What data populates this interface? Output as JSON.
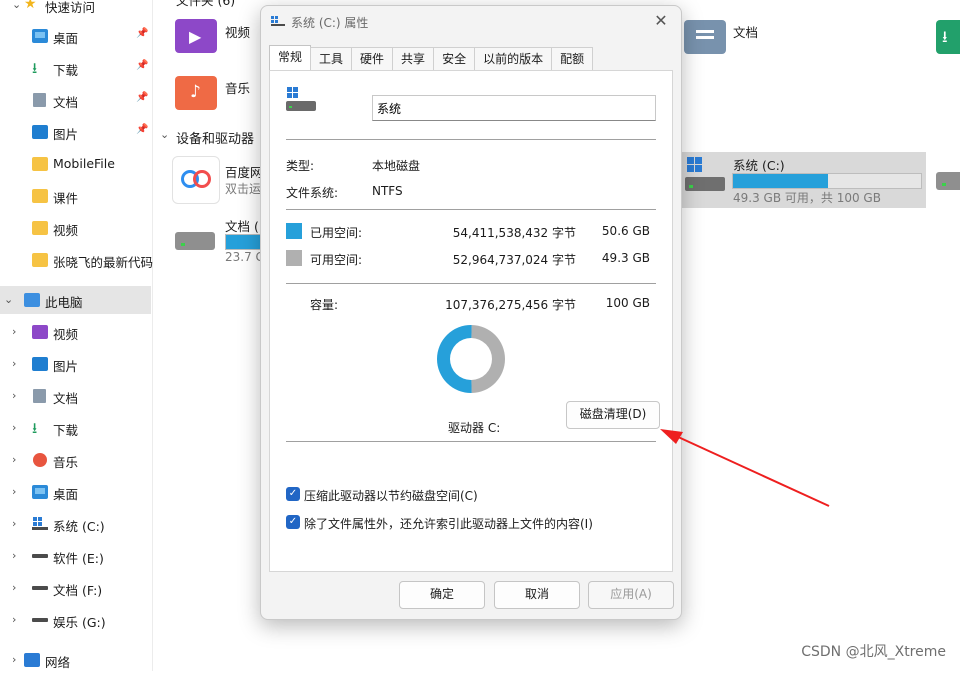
{
  "sidebar": {
    "quick_access_label": "快速访问",
    "quick_items": [
      {
        "label": "桌面",
        "icon": "desktop-icon"
      },
      {
        "label": "下载",
        "icon": "download-icon"
      },
      {
        "label": "文档",
        "icon": "document-icon"
      },
      {
        "label": "图片",
        "icon": "pictures-icon"
      },
      {
        "label": "MobileFile",
        "icon": "folder-icon"
      },
      {
        "label": "课件",
        "icon": "folder-icon"
      },
      {
        "label": "视频",
        "icon": "folder-icon"
      },
      {
        "label": "张晓飞的最新代码",
        "icon": "folder-icon"
      }
    ],
    "this_pc_label": "此电脑",
    "pc_items": [
      {
        "label": "视频",
        "icon": "videos-icon"
      },
      {
        "label": "图片",
        "icon": "pictures-icon"
      },
      {
        "label": "文档",
        "icon": "document-icon"
      },
      {
        "label": "下载",
        "icon": "download-icon"
      },
      {
        "label": "音乐",
        "icon": "music-icon"
      },
      {
        "label": "桌面",
        "icon": "desktop-icon"
      },
      {
        "label": "系统 (C:)",
        "icon": "windows-drive-icon"
      },
      {
        "label": "软件 (E:)",
        "icon": "drive-icon"
      },
      {
        "label": "文档 (F:)",
        "icon": "drive-icon"
      },
      {
        "label": "娱乐 (G:)",
        "icon": "drive-icon"
      }
    ],
    "network_label": "网络"
  },
  "content": {
    "folders_header": "文件夹 (6)",
    "folders": [
      "视频",
      "音乐",
      "文档"
    ],
    "devices_header": "设备和驱动器",
    "baidu_name": "百度网",
    "baidu_sub": "双击运",
    "doc_drive_name": "文档 (F",
    "doc_drive_free": "23.7 G",
    "c_drive_name": "系统 (C:)",
    "c_drive_free": "49.3 GB 可用，共 100 GB",
    "c_drive_used_fraction": 0.506
  },
  "dialog": {
    "title": "系统 (C:) 属性",
    "tabs": [
      "常规",
      "工具",
      "硬件",
      "共享",
      "安全",
      "以前的版本",
      "配额"
    ],
    "active_tab": "常规",
    "name_value": "系统",
    "type_label": "类型:",
    "type_value": "本地磁盘",
    "fs_label": "文件系统:",
    "fs_value": "NTFS",
    "used_label": "已用空间:",
    "used_bytes": "54,411,538,432 字节",
    "used_gb": "50.6 GB",
    "free_label": "可用空间:",
    "free_bytes": "52,964,737,024 字节",
    "free_gb": "49.3 GB",
    "capacity_label": "容量:",
    "capacity_bytes": "107,376,275,456 字节",
    "capacity_gb": "100 GB",
    "drive_label": "驱动器 C:",
    "cleanup_button": "磁盘清理(D)",
    "compress_label": "压缩此驱动器以节约磁盘空间(C)",
    "index_label": "除了文件属性外，还允许索引此驱动器上文件的内容(I)",
    "ok_button": "确定",
    "cancel_button": "取消",
    "apply_button": "应用(A)",
    "used_color": "#26a0da",
    "free_color": "#b0b0b0",
    "used_fraction": 0.506
  },
  "watermark": "CSDN @北风_Xtreme"
}
